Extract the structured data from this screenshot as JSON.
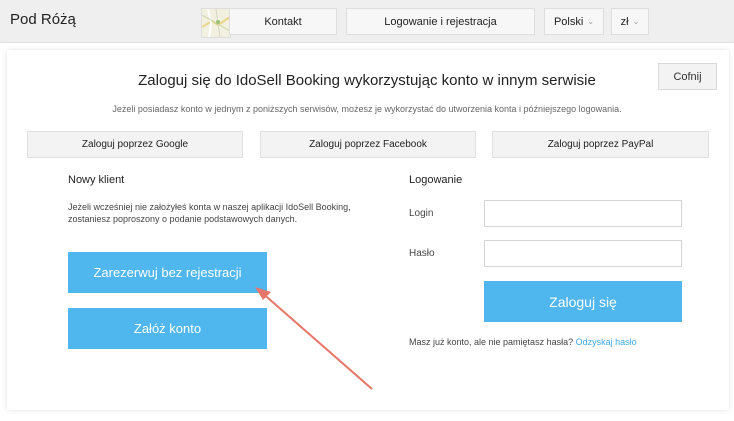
{
  "header": {
    "brand": "Pod Różą",
    "contact_label": "Kontakt",
    "login_register_label": "Logowanie i rejestracja",
    "language_label": "Polski",
    "currency_label": "zł"
  },
  "login_panel": {
    "heading": "Zaloguj się do IdoSell Booking wykorzystując konto w innym serwisie",
    "subtext": "Jeżeli posiadasz konto w jednym z poniższych serwisów, możesz je wykorzystać do utworzenia konta i późniejszego logowania.",
    "back_label": "Cofnij",
    "social_buttons": [
      {
        "label": "Zaloguj poprzez Google"
      },
      {
        "label": "Zaloguj poprzez Facebook"
      },
      {
        "label": "Zaloguj poprzez PayPal"
      }
    ]
  },
  "new_client": {
    "title": "Nowy klient",
    "description": "Jeżeli wcześniej nie założyłeś konta w naszej aplikacji IdoSell Booking, zostaniesz poproszony o podanie podstawowych danych.",
    "reserve_label": "Zarezerwuj bez rejestracji",
    "create_account_label": "Załóż konto"
  },
  "login": {
    "title": "Logowanie",
    "login_label": "Login",
    "login_value": "",
    "password_label": "Hasło",
    "password_value": "",
    "submit_label": "Zaloguj się",
    "forgot_text": "Masz już konto, ale nie pamiętasz hasła?",
    "recover_link": "Odzyskaj hasło"
  },
  "colors": {
    "accent": "#4fb6ee",
    "link": "#3fa9e6",
    "annotation_arrow": "#e8756a"
  }
}
